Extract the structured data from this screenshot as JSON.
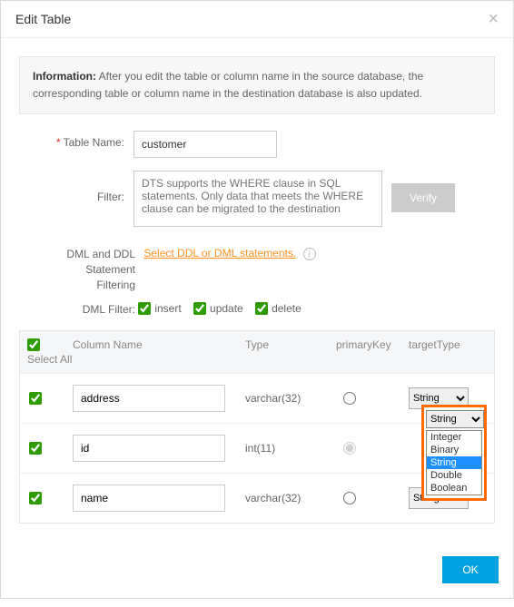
{
  "dialog": {
    "title": "Edit Table"
  },
  "info": {
    "label": "Information:",
    "text": "After you edit the table or column name in the source database, the corresponding table or column name in the destination database is also updated."
  },
  "form": {
    "tableName": {
      "label": "Table Name:",
      "value": "customer"
    },
    "filter": {
      "label": "Filter:",
      "placeholder": "DTS supports the WHERE clause in SQL statements. Only data that meets the WHERE clause can be migrated to the destination",
      "verify": "Verify"
    },
    "ddl": {
      "label": "DML and DDL Statement Filtering",
      "link": "Select DDL or DML statements."
    },
    "dml": {
      "label": "DML Filter:",
      "insert": "insert",
      "update": "update",
      "delete": "delete"
    }
  },
  "table": {
    "head": {
      "selectAll": "Select All",
      "col": "Column Name",
      "type": "Type",
      "pk": "primaryKey",
      "tt": "targetType"
    },
    "rows": [
      {
        "name": "address",
        "type": "varchar(32)",
        "pk": false,
        "tt": "String"
      },
      {
        "name": "id",
        "type": "int(11)",
        "pk": true,
        "tt": "String"
      },
      {
        "name": "name",
        "type": "varchar(32)",
        "pk": false,
        "tt": "String"
      }
    ]
  },
  "dropdown": {
    "selected": "String",
    "items": [
      "Integer",
      "Binary",
      "String",
      "Double",
      "Boolean"
    ]
  },
  "footer": {
    "ok": "OK"
  }
}
